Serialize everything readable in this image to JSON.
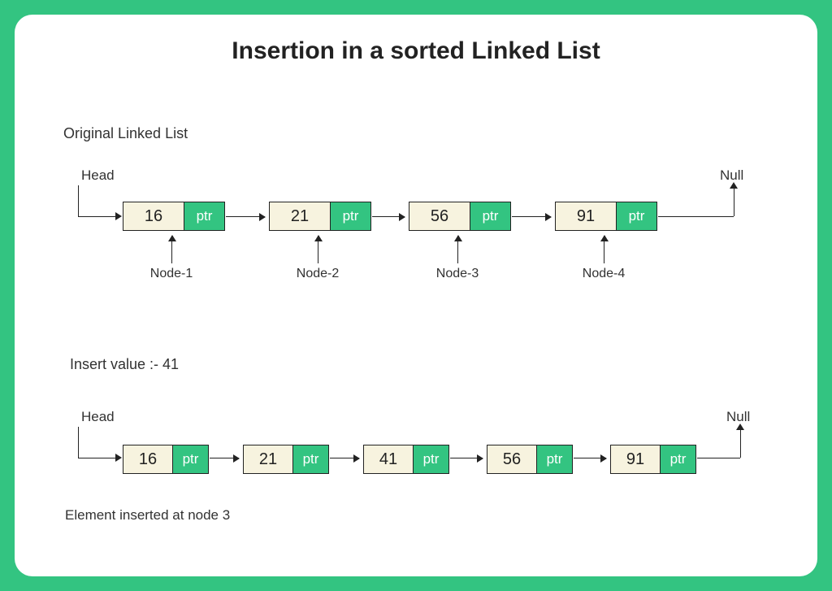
{
  "title": "Insertion in a sorted Linked List",
  "labels": {
    "original": "Original Linked List",
    "head": "Head",
    "null": "Null",
    "insert_prompt": "Insert value :-  41",
    "result_note": "Element inserted at node 3",
    "ptr": "ptr"
  },
  "list1": {
    "nodes": [
      {
        "value": "16",
        "label": "Node-1"
      },
      {
        "value": "21",
        "label": "Node-2"
      },
      {
        "value": "56",
        "label": "Node-3"
      },
      {
        "value": "91",
        "label": "Node-4"
      }
    ]
  },
  "list2": {
    "nodes": [
      {
        "value": "16"
      },
      {
        "value": "21"
      },
      {
        "value": "41"
      },
      {
        "value": "56"
      },
      {
        "value": "91"
      }
    ]
  }
}
